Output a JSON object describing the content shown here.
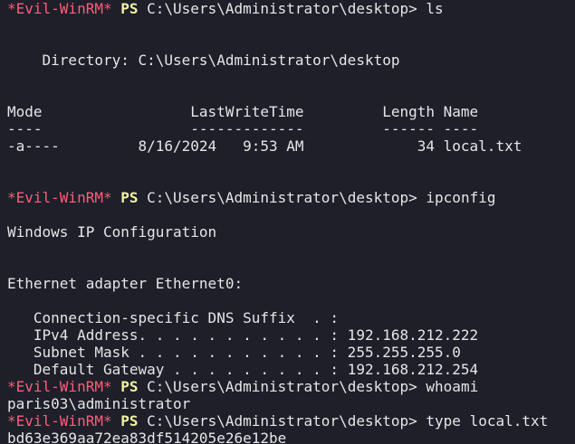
{
  "colors": {
    "background": "#1e1f29",
    "text": "#e6e6e6",
    "evil_prompt": "#ff5c7a",
    "ps_prompt": "#f4f4a0"
  },
  "prompt": {
    "evil": "*Evil-WinRM*",
    "ps": "PS",
    "path": "C:\\Users\\Administrator\\desktop>"
  },
  "lines": [
    {
      "type": "prompt",
      "cmd": "ls"
    },
    {
      "type": "blank"
    },
    {
      "type": "blank"
    },
    {
      "type": "text",
      "text": "    Directory: C:\\Users\\Administrator\\desktop"
    },
    {
      "type": "blank"
    },
    {
      "type": "blank"
    },
    {
      "type": "text",
      "text": "Mode                 LastWriteTime         Length Name"
    },
    {
      "type": "text",
      "text": "----                 -------------         ------ ----"
    },
    {
      "type": "text",
      "text": "-a----         8/16/2024   9:53 AM             34 local.txt"
    },
    {
      "type": "blank"
    },
    {
      "type": "blank"
    },
    {
      "type": "prompt",
      "cmd": "ipconfig"
    },
    {
      "type": "blank"
    },
    {
      "type": "text",
      "text": "Windows IP Configuration"
    },
    {
      "type": "blank"
    },
    {
      "type": "blank"
    },
    {
      "type": "text",
      "text": "Ethernet adapter Ethernet0:"
    },
    {
      "type": "blank"
    },
    {
      "type": "text",
      "text": "   Connection-specific DNS Suffix  . :"
    },
    {
      "type": "text",
      "text": "   IPv4 Address. . . . . . . . . . . : 192.168.212.222"
    },
    {
      "type": "text",
      "text": "   Subnet Mask . . . . . . . . . . . : 255.255.255.0"
    },
    {
      "type": "text",
      "text": "   Default Gateway . . . . . . . . . : 192.168.212.254"
    },
    {
      "type": "prompt",
      "cmd": "whoami"
    },
    {
      "type": "text",
      "text": "paris03\\administrator"
    },
    {
      "type": "prompt",
      "cmd": "type local.txt"
    },
    {
      "type": "text",
      "text": "bd63e369aa72ea83df514205e26e12be"
    }
  ]
}
